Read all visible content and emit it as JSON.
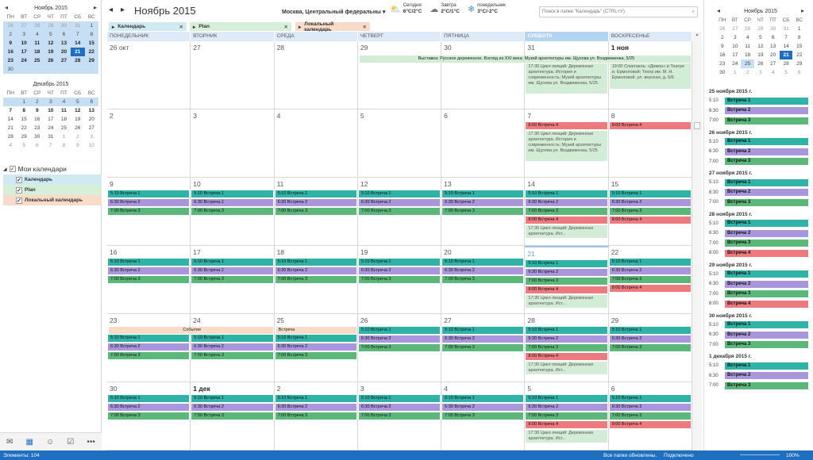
{
  "status": {
    "items_label": "Элементы: 104",
    "folders_updated": "Все папки обновлены.",
    "connected": "Подключено",
    "zoom": "100%"
  },
  "mini_cal_1": {
    "title": "Ноябрь 2015",
    "weekdays": [
      "ПН",
      "ВТ",
      "СР",
      "ЧТ",
      "ПТ",
      "СБ",
      "ВС"
    ],
    "weeks": [
      [
        "26",
        "27",
        "28",
        "29",
        "30",
        "31",
        "1"
      ],
      [
        "2",
        "3",
        "4",
        "5",
        "6",
        "7",
        "8"
      ],
      [
        "9",
        "10",
        "11",
        "12",
        "13",
        "14",
        "15"
      ],
      [
        "16",
        "17",
        "18",
        "19",
        "20",
        "21",
        "22"
      ],
      [
        "23",
        "24",
        "25",
        "26",
        "27",
        "28",
        "29"
      ],
      [
        "30",
        "",
        "",
        "",
        "",
        "",
        ""
      ]
    ]
  },
  "mini_cal_2": {
    "title": "Декабрь 2015",
    "weekdays": [
      "ПН",
      "ВТ",
      "СР",
      "ЧТ",
      "ПТ",
      "СБ",
      "ВС"
    ],
    "weeks": [
      [
        "",
        "1",
        "2",
        "3",
        "4",
        "5",
        "6"
      ],
      [
        "7",
        "8",
        "9",
        "10",
        "11",
        "12",
        "13"
      ],
      [
        "14",
        "15",
        "16",
        "17",
        "18",
        "19",
        "20"
      ],
      [
        "21",
        "22",
        "23",
        "24",
        "25",
        "26",
        "27"
      ],
      [
        "28",
        "29",
        "30",
        "31",
        "1",
        "2",
        "3"
      ],
      [
        "4",
        "5",
        "6",
        "7",
        "8",
        "9",
        "10"
      ]
    ]
  },
  "my_calendars": {
    "heading": "Мои календари",
    "items": [
      {
        "label": "Календарь",
        "color": "#cfeaf3"
      },
      {
        "label": "Plan",
        "color": "#d7eed8"
      },
      {
        "label": "Локальный календарь",
        "color": "#f8dcc9"
      }
    ]
  },
  "header": {
    "month_title": "Ноябрь 2015",
    "location": "Москва, Центральный федеральны",
    "weather": [
      {
        "label": "Сегодня",
        "temp": "6°C/2°C"
      },
      {
        "label": "Завтра",
        "temp": "2°C/1°C"
      },
      {
        "label": "понедельник",
        "temp": "3°C/-2°C"
      }
    ],
    "search_placeholder": "Поиск в папке \"Календарь\" (CTRL+У)"
  },
  "tabs": [
    {
      "label": "Календарь",
      "color": "#cfeaf3"
    },
    {
      "label": "Plan",
      "color": "#d7eed8"
    },
    {
      "label": "Локальный календарь",
      "color": "#f8dcc9"
    }
  ],
  "day_headers": [
    "ПОНЕДЕЛЬНИК",
    "ВТОРНИК",
    "СРЕДА",
    "ЧЕТВЕРГ",
    "ПЯТНИЦА",
    "СУББОТА",
    "ВОСКРЕСЕНЬЕ"
  ],
  "events": {
    "m1": "5:10 Встреча 1",
    "m2": "6:30 Встреча 2",
    "m3": "7:00 Встреча 3",
    "m4": "8:00 Встреча 4",
    "lecture_full": "17:30 Цикл лекций: Деревянная архитектура. История и современность; Музей архитектуры им. Щусева ул. Воздвиженка, 5/25",
    "lecture_short": "17:30 Цикл лекций: Деревянная архитектура. Ист...",
    "exhibition": "Выставка: Русское деревянное. Взгляд из XXI века; Музей архитектуры им. Щусева ул. Воздвиженка, 5/25",
    "theatre": "19:00 Спектакль: «Демон» в Театре и. Ермоловой; Театр им. М. Н. Ермоловой. ул. верская, д. 5/6",
    "event_label": "Событие",
    "meeting_label": "Встреча"
  },
  "weeks": [
    [
      "26 окт",
      "27",
      "28",
      "29",
      "30",
      "31",
      "1 ноя"
    ],
    [
      "2",
      "3",
      "4",
      "5",
      "6",
      "7",
      "8"
    ],
    [
      "9",
      "10",
      "11",
      "12",
      "13",
      "14",
      "15"
    ],
    [
      "16",
      "17",
      "18",
      "19",
      "20",
      "21",
      "22"
    ],
    [
      "23",
      "24",
      "25",
      "26",
      "27",
      "28",
      "29"
    ],
    [
      "30",
      "1 дек",
      "2",
      "3",
      "4",
      "5",
      "6"
    ]
  ],
  "agenda_cal": {
    "title": "Ноябрь 2015",
    "weekdays": [
      "ПН",
      "ВТ",
      "СР",
      "ЧТ",
      "ПТ",
      "СБ",
      "ВС"
    ],
    "weeks": [
      [
        "26",
        "27",
        "28",
        "29",
        "30",
        "31",
        "1"
      ],
      [
        "2",
        "3",
        "4",
        "5",
        "6",
        "7",
        "8"
      ],
      [
        "9",
        "10",
        "11",
        "12",
        "13",
        "14",
        "15"
      ],
      [
        "16",
        "17",
        "18",
        "19",
        "20",
        "21",
        "22"
      ],
      [
        "23",
        "24",
        "25",
        "26",
        "27",
        "28",
        "29"
      ],
      [
        "30",
        "1",
        "2",
        "3",
        "4",
        "5",
        "6"
      ]
    ]
  },
  "agenda": [
    {
      "date": "25 ноября 2015 г.",
      "items": [
        {
          "time": "5:10",
          "label": "Встреча 1",
          "c": "e1"
        },
        {
          "time": "6:30",
          "label": "Встреча 2",
          "c": "e2"
        },
        {
          "time": "7:00",
          "label": "Встреча 3",
          "c": "e3"
        }
      ]
    },
    {
      "date": "26 ноября 2015 г.",
      "items": [
        {
          "time": "5:10",
          "label": "Встреча 1",
          "c": "e1"
        },
        {
          "time": "6:30",
          "label": "Встреча 2",
          "c": "e2"
        },
        {
          "time": "7:00",
          "label": "Встреча 3",
          "c": "e3"
        }
      ]
    },
    {
      "date": "27 ноября 2015 г.",
      "items": [
        {
          "time": "5:10",
          "label": "Встреча 1",
          "c": "e1"
        },
        {
          "time": "6:30",
          "label": "Встреча 2",
          "c": "e2"
        },
        {
          "time": "7:00",
          "label": "Встреча 3",
          "c": "e3"
        }
      ]
    },
    {
      "date": "28 ноября 2015 г.",
      "items": [
        {
          "time": "5:10",
          "label": "Встреча 1",
          "c": "e1"
        },
        {
          "time": "6:30",
          "label": "Встреча 2",
          "c": "e2"
        },
        {
          "time": "7:00",
          "label": "Встреча 3",
          "c": "e3"
        },
        {
          "time": "8:00",
          "label": "Встреча 4",
          "c": "e4"
        }
      ]
    },
    {
      "date": "29 ноября 2015 г.",
      "items": [
        {
          "time": "5:10",
          "label": "Встреча 1",
          "c": "e1"
        },
        {
          "time": "6:30",
          "label": "Встреча 2",
          "c": "e2"
        },
        {
          "time": "7:00",
          "label": "Встреча 3",
          "c": "e3"
        },
        {
          "time": "8:00",
          "label": "Встреча 4",
          "c": "e4"
        }
      ]
    },
    {
      "date": "30 ноября 2015 г.",
      "items": [
        {
          "time": "5:10",
          "label": "Встреча 1",
          "c": "e1"
        },
        {
          "time": "6:30",
          "label": "Встреча 2",
          "c": "e2"
        },
        {
          "time": "7:00",
          "label": "Встреча 3",
          "c": "e3"
        }
      ]
    },
    {
      "date": "1 декабря 2015 г.",
      "items": [
        {
          "time": "5:10",
          "label": "Встреча 1",
          "c": "e1"
        },
        {
          "time": "6:30",
          "label": "Встреча 2",
          "c": "e2"
        },
        {
          "time": "7:00",
          "label": "Встреча 3",
          "c": "e3"
        }
      ]
    }
  ]
}
